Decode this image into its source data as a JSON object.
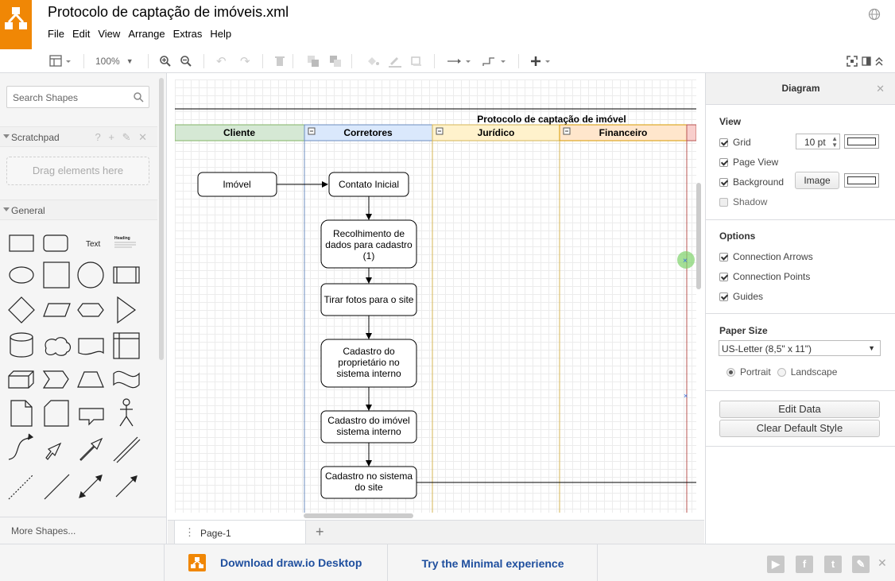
{
  "app": {
    "file_title": "Protocolo de captação de imóveis.xml",
    "menus": [
      "File",
      "Edit",
      "View",
      "Arrange",
      "Extras",
      "Help"
    ]
  },
  "toolbar": {
    "zoom_label": "100%"
  },
  "left_panel": {
    "search_placeholder": "Search Shapes",
    "scratchpad_label": "Scratchpad",
    "scratchpad_tools": "? + ✎ ✕",
    "drag_hint": "Drag elements here",
    "general_label": "General",
    "text_shape": "Text",
    "heading_shape": "Heading",
    "more_shapes": "More Shapes..."
  },
  "diagram": {
    "pool_title": "Protocolo de captação de imóvel",
    "lanes": [
      "Cliente",
      "Corretores",
      "Jurídico",
      "Financeiro"
    ],
    "nodes": {
      "imovel": "Imóvel",
      "contato": "Contato Inicial",
      "recolhimento": "Recolhimento de dados para cadastro (1)",
      "fotos": "Tirar fotos para o site",
      "proprietario": "Cadastro do proprietário no sistema interno",
      "imovel_sistema": "Cadastro do imóvel sistema interno",
      "site": "Cadastro no sistema do site"
    }
  },
  "page_tabs": {
    "current": "Page-1"
  },
  "right_panel": {
    "tab_label": "Diagram",
    "view_heading": "View",
    "grid_label": "Grid",
    "grid_size": "10 pt",
    "page_view_label": "Page View",
    "background_label": "Background",
    "image_button": "Image",
    "shadow_label": "Shadow",
    "options_heading": "Options",
    "connection_arrows": "Connection Arrows",
    "connection_points": "Connection Points",
    "guides": "Guides",
    "paper_heading": "Paper Size",
    "paper_value": "US-Letter (8,5\" x 11\")",
    "portrait": "Portrait",
    "landscape": "Landscape",
    "edit_data": "Edit Data",
    "clear_style": "Clear Default Style",
    "checks": {
      "grid": true,
      "page_view": true,
      "background": true,
      "shadow": false,
      "arrows": true,
      "points": true,
      "guides": true
    }
  },
  "footer": {
    "download": "Download draw.io Desktop",
    "minimal": "Try the Minimal experience"
  },
  "colors": {
    "brand_orange": "#f08705",
    "link_blue": "#1f4f9e",
    "lane_cliente": "#d5e8d4",
    "lane_corretores": "#dae8fc",
    "lane_juridico": "#fff2cc",
    "lane_financeiro": "#ffe6cc"
  }
}
